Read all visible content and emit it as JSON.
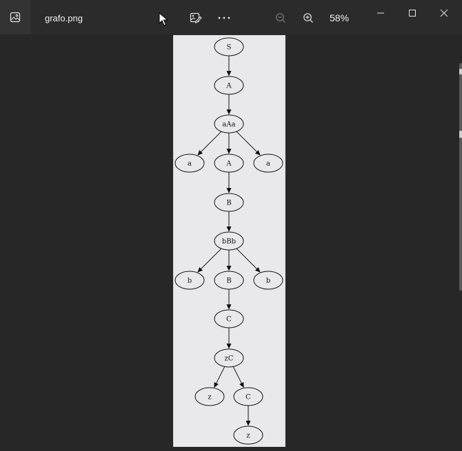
{
  "window": {
    "title": "grafo.png",
    "zoom": "58%",
    "corner_fragment": "........"
  },
  "icons": {
    "app": "photos-image-icon",
    "edit": "edit-image-icon",
    "more": "more-options-icon",
    "zoom_out": "zoom-out-icon",
    "zoom_in": "zoom-in-icon",
    "minimize": "minimize-icon",
    "maximize": "maximize-icon",
    "close": "close-icon"
  },
  "colors": {
    "titlebar": "#2b2b2b",
    "background": "#272727",
    "canvas": "#e9e8ea"
  },
  "graph": {
    "nodes": [
      {
        "id": "n1",
        "label": "S"
      },
      {
        "id": "n2",
        "label": "A"
      },
      {
        "id": "n3",
        "label": "aAa"
      },
      {
        "id": "n4",
        "label": "a"
      },
      {
        "id": "n5",
        "label": "A"
      },
      {
        "id": "n6",
        "label": "a"
      },
      {
        "id": "n7",
        "label": "B"
      },
      {
        "id": "n8",
        "label": "bBb"
      },
      {
        "id": "n9",
        "label": "b"
      },
      {
        "id": "n10",
        "label": "B"
      },
      {
        "id": "n11",
        "label": "b"
      },
      {
        "id": "n12",
        "label": "C"
      },
      {
        "id": "n13",
        "label": "zC"
      },
      {
        "id": "n14",
        "label": "z"
      },
      {
        "id": "n15",
        "label": "C"
      },
      {
        "id": "n16",
        "label": "z"
      }
    ],
    "edges": [
      [
        "n1",
        "n2"
      ],
      [
        "n2",
        "n3"
      ],
      [
        "n3",
        "n4"
      ],
      [
        "n3",
        "n5"
      ],
      [
        "n3",
        "n6"
      ],
      [
        "n5",
        "n7"
      ],
      [
        "n7",
        "n8"
      ],
      [
        "n8",
        "n9"
      ],
      [
        "n8",
        "n10"
      ],
      [
        "n8",
        "n11"
      ],
      [
        "n10",
        "n12"
      ],
      [
        "n12",
        "n13"
      ],
      [
        "n13",
        "n14"
      ],
      [
        "n13",
        "n15"
      ],
      [
        "n15",
        "n16"
      ]
    ]
  }
}
